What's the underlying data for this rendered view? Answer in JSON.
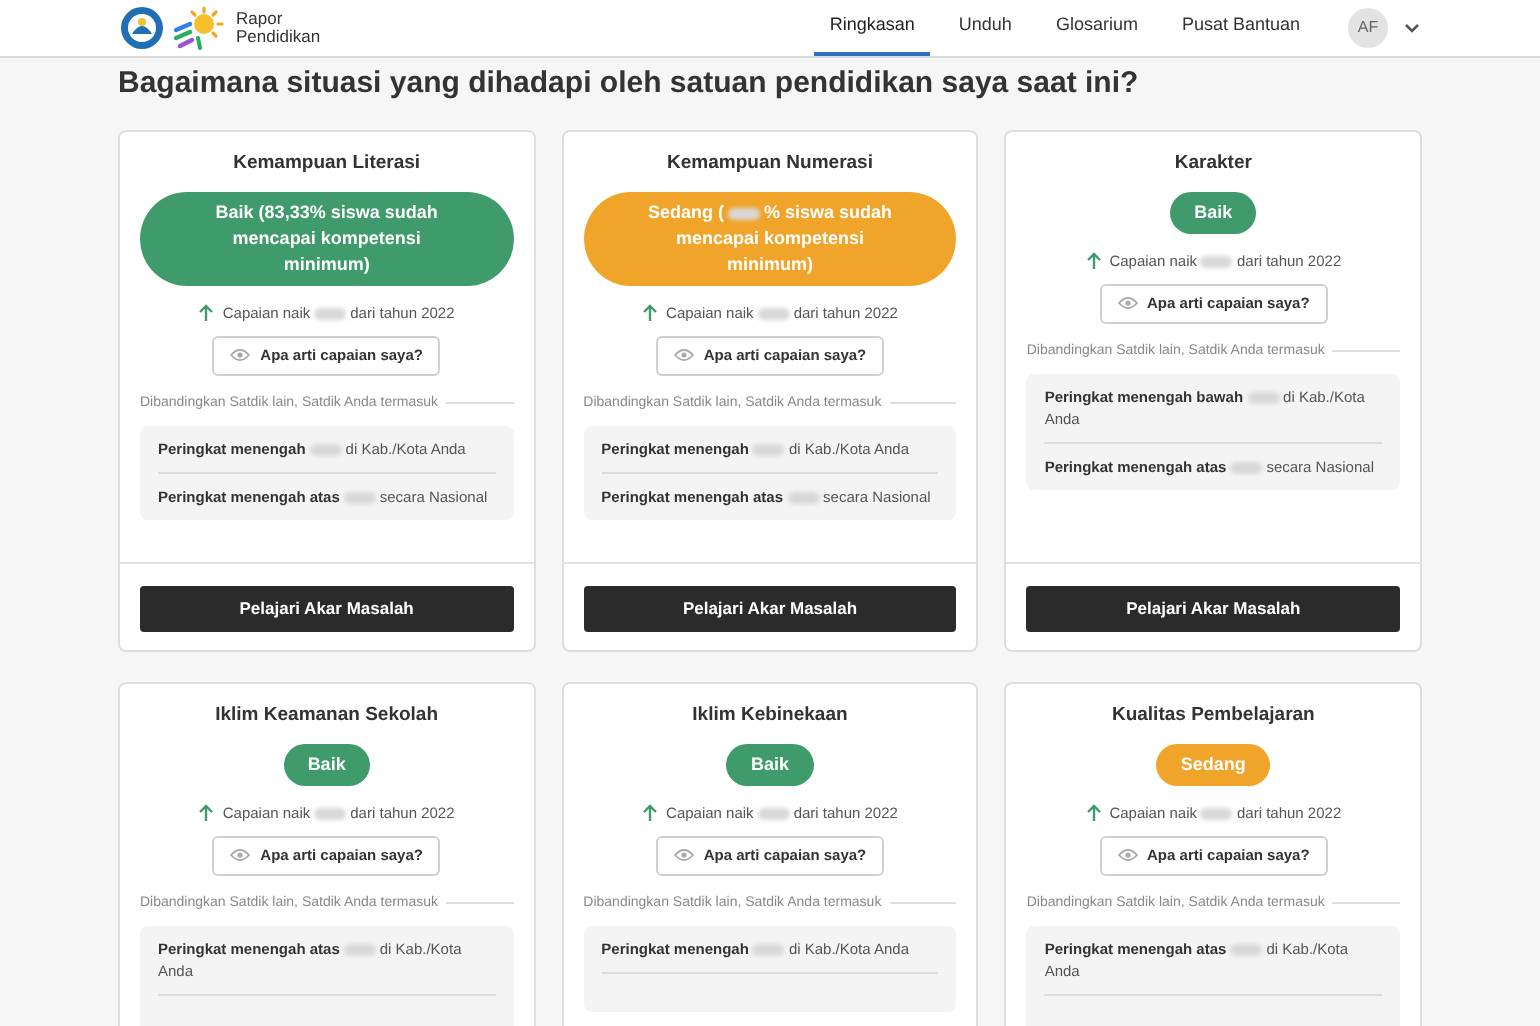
{
  "header": {
    "logo_text": [
      "Rapor",
      "Pendidikan"
    ],
    "nav": [
      {
        "label": "Ringkasan",
        "selected": true
      },
      {
        "label": "Unduh",
        "selected": false
      },
      {
        "label": "Glosarium",
        "selected": false
      },
      {
        "label": "Pusat Bantuan",
        "selected": false
      }
    ],
    "avatar": "AF"
  },
  "heading": "Bagaimana situasi yang dihadapi oleh satuan pendidikan saya saat ini?",
  "cards": [
    {
      "title": "Kemampuan Literasi",
      "status": {
        "color": "#3f9a6c",
        "parts": [
          "Baik (83,33% siswa sudah mencapai kompetensi minimum)"
        ]
      },
      "change": [
        "Capaian naik",
        {
          "kind": "redacted"
        },
        "dari tahun 2022"
      ],
      "help": "Apa arti capaian saya?",
      "compare": "Dibandingkan Satdik lain, Satdik Anda termasuk",
      "ranks": [
        {
          "label": "Peringkat menengah",
          "rest": "di Kab./Kota Anda"
        },
        {
          "label": "Peringkat menengah atas",
          "rest": "secara Nasional"
        }
      ],
      "action": "Pelajari Akar Masalah"
    },
    {
      "title": "Kemampuan Numerasi",
      "status": {
        "color": "#f0a42a",
        "parts": [
          "Sedang (",
          {
            "kind": "redacted"
          },
          "% siswa sudah mencapai kompetensi minimum)"
        ]
      },
      "change": [
        "Capaian naik",
        {
          "kind": "redacted"
        },
        "dari tahun 2022"
      ],
      "help": "Apa arti capaian saya?",
      "compare": "Dibandingkan Satdik lain, Satdik Anda termasuk",
      "ranks": [
        {
          "label": "Peringkat menengah",
          "rest": "di Kab./Kota Anda"
        },
        {
          "label": "Peringkat menengah atas",
          "rest": "secara Nasional"
        }
      ],
      "action": "Pelajari Akar Masalah"
    },
    {
      "title": "Karakter",
      "status": {
        "color": "#3f9a6c",
        "parts": [
          "Baik"
        ]
      },
      "change": [
        "Capaian naik",
        {
          "kind": "redacted"
        },
        "dari tahun 2022"
      ],
      "help": "Apa arti capaian saya?",
      "compare": "Dibandingkan Satdik lain, Satdik Anda termasuk",
      "ranks": [
        {
          "label": "Peringkat menengah bawah",
          "rest": "di Kab./Kota Anda"
        },
        {
          "label": "Peringkat menengah atas",
          "rest": "secara Nasional"
        }
      ],
      "action": "Pelajari Akar Masalah"
    },
    {
      "title": "Iklim Keamanan Sekolah",
      "status": {
        "color": "#3f9a6c",
        "parts": [
          "Baik"
        ]
      },
      "change": [
        "Capaian naik",
        {
          "kind": "redacted"
        },
        "dari tahun 2022"
      ],
      "help": "Apa arti capaian saya?",
      "compare": "Dibandingkan Satdik lain, Satdik Anda termasuk",
      "ranks": [
        {
          "label": "Peringkat menengah atas",
          "rest": "di Kab./Kota Anda"
        }
      ]
    },
    {
      "title": "Iklim Kebinekaan",
      "status": {
        "color": "#3f9a6c",
        "parts": [
          "Baik"
        ]
      },
      "change": [
        "Capaian naik",
        {
          "kind": "redacted"
        },
        "dari tahun 2022"
      ],
      "help": "Apa arti capaian saya?",
      "compare": "Dibandingkan Satdik lain, Satdik Anda termasuk",
      "ranks": [
        {
          "label": "Peringkat menengah",
          "rest": "di Kab./Kota Anda"
        }
      ]
    },
    {
      "title": "Kualitas Pembelajaran",
      "status": {
        "color": "#f0a42a",
        "parts": [
          "Sedang"
        ]
      },
      "change": [
        "Capaian naik",
        {
          "kind": "redacted"
        },
        "dari tahun 2022"
      ],
      "help": "Apa arti capaian saya?",
      "compare": "Dibandingkan Satdik lain, Satdik Anda termasuk",
      "ranks": [
        {
          "label": "Peringkat menengah atas",
          "rest": "di Kab./Kota Anda"
        }
      ]
    }
  ]
}
